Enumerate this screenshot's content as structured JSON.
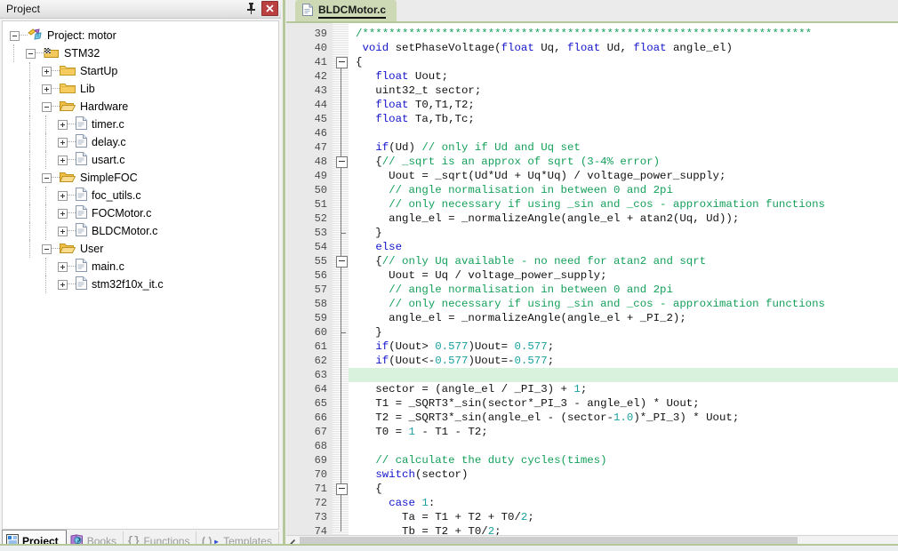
{
  "project_panel": {
    "title": "Project",
    "pin_icon": "pin-icon",
    "close_icon": "close-icon",
    "tree": [
      {
        "label": "Project: motor",
        "depth": 0,
        "expander": "minus",
        "icon": "project-icon"
      },
      {
        "label": "STM32",
        "depth": 1,
        "expander": "minus",
        "icon": "target-icon"
      },
      {
        "label": "StartUp",
        "depth": 2,
        "expander": "plus",
        "icon": "folder-closed-icon"
      },
      {
        "label": "Lib",
        "depth": 2,
        "expander": "plus",
        "icon": "folder-closed-icon"
      },
      {
        "label": "Hardware",
        "depth": 2,
        "expander": "minus",
        "icon": "folder-open-icon"
      },
      {
        "label": "timer.c",
        "depth": 3,
        "expander": "plus",
        "icon": "file-c-icon"
      },
      {
        "label": "delay.c",
        "depth": 3,
        "expander": "plus",
        "icon": "file-c-icon"
      },
      {
        "label": "usart.c",
        "depth": 3,
        "expander": "plus",
        "icon": "file-c-icon"
      },
      {
        "label": "SimpleFOC",
        "depth": 2,
        "expander": "minus",
        "icon": "folder-open-icon"
      },
      {
        "label": "foc_utils.c",
        "depth": 3,
        "expander": "plus",
        "icon": "file-c-icon"
      },
      {
        "label": "FOCMotor.c",
        "depth": 3,
        "expander": "plus",
        "icon": "file-c-icon"
      },
      {
        "label": "BLDCMotor.c",
        "depth": 3,
        "expander": "plus",
        "icon": "file-c-icon"
      },
      {
        "label": "User",
        "depth": 2,
        "expander": "minus",
        "icon": "folder-open-icon"
      },
      {
        "label": "main.c",
        "depth": 3,
        "expander": "plus",
        "icon": "file-c-icon"
      },
      {
        "label": "stm32f10x_it.c",
        "depth": 3,
        "expander": "plus",
        "icon": "file-c-icon"
      }
    ],
    "bottom_tabs": [
      {
        "label": "Project",
        "active": true,
        "icon": "project-tab-icon"
      },
      {
        "label": "Books",
        "active": false,
        "icon": "books-icon"
      },
      {
        "label": "Functions",
        "active": false,
        "icon": "braces-icon"
      },
      {
        "label": "Templates",
        "active": false,
        "icon": "templates-icon"
      }
    ]
  },
  "editor": {
    "tab": {
      "label": "BLDCMotor.c",
      "icon": "file-c-icon",
      "active": true
    },
    "first_line_number": 39,
    "current_line": 63,
    "scrollbar": {
      "left_arrow_icon": "chevron-left-icon"
    },
    "folds": [
      {
        "line": 41,
        "type": "open"
      },
      {
        "line": 48,
        "type": "open"
      },
      {
        "line": 53,
        "type": "end"
      },
      {
        "line": 55,
        "type": "open"
      },
      {
        "line": 60,
        "type": "end"
      },
      {
        "line": 71,
        "type": "open"
      }
    ],
    "lines": [
      {
        "n": 39,
        "tokens": [
          {
            "t": "cm",
            "s": "/********************************************************************"
          }
        ]
      },
      {
        "n": 40,
        "tokens": [
          {
            "t": "pl",
            "s": " "
          },
          {
            "t": "kw",
            "s": "void"
          },
          {
            "t": "pl",
            "s": " setPhaseVoltage("
          },
          {
            "t": "kw",
            "s": "float"
          },
          {
            "t": "pl",
            "s": " Uq, "
          },
          {
            "t": "kw",
            "s": "float"
          },
          {
            "t": "pl",
            "s": " Ud, "
          },
          {
            "t": "kw",
            "s": "float"
          },
          {
            "t": "pl",
            "s": " angle_el)"
          }
        ]
      },
      {
        "n": 41,
        "tokens": [
          {
            "t": "pl",
            "s": "{"
          }
        ]
      },
      {
        "n": 42,
        "tokens": [
          {
            "t": "pl",
            "s": "   "
          },
          {
            "t": "kw",
            "s": "float"
          },
          {
            "t": "pl",
            "s": " Uout;"
          }
        ]
      },
      {
        "n": 43,
        "tokens": [
          {
            "t": "pl",
            "s": "   uint32_t sector;"
          }
        ]
      },
      {
        "n": 44,
        "tokens": [
          {
            "t": "pl",
            "s": "   "
          },
          {
            "t": "kw",
            "s": "float"
          },
          {
            "t": "pl",
            "s": " T0,T1,T2;"
          }
        ]
      },
      {
        "n": 45,
        "tokens": [
          {
            "t": "pl",
            "s": "   "
          },
          {
            "t": "kw",
            "s": "float"
          },
          {
            "t": "pl",
            "s": " Ta,Tb,Tc;"
          }
        ]
      },
      {
        "n": 46,
        "tokens": [
          {
            "t": "pl",
            "s": ""
          }
        ]
      },
      {
        "n": 47,
        "tokens": [
          {
            "t": "pl",
            "s": "   "
          },
          {
            "t": "kw",
            "s": "if"
          },
          {
            "t": "pl",
            "s": "(Ud) "
          },
          {
            "t": "cm",
            "s": "// only if Ud and Uq set"
          }
        ]
      },
      {
        "n": 48,
        "tokens": [
          {
            "t": "pl",
            "s": "   {"
          },
          {
            "t": "cm",
            "s": "// _sqrt is an approx of sqrt (3-4% error)"
          }
        ]
      },
      {
        "n": 49,
        "tokens": [
          {
            "t": "pl",
            "s": "     Uout = _sqrt(Ud*Ud + Uq*Uq) / voltage_power_supply;"
          }
        ]
      },
      {
        "n": 50,
        "tokens": [
          {
            "t": "pl",
            "s": "     "
          },
          {
            "t": "cm",
            "s": "// angle normalisation in between 0 and 2pi"
          }
        ]
      },
      {
        "n": 51,
        "tokens": [
          {
            "t": "pl",
            "s": "     "
          },
          {
            "t": "cm",
            "s": "// only necessary if using _sin and _cos - approximation functions"
          }
        ]
      },
      {
        "n": 52,
        "tokens": [
          {
            "t": "pl",
            "s": "     angle_el = _normalizeAngle(angle_el + atan2(Uq, Ud));"
          }
        ]
      },
      {
        "n": 53,
        "tokens": [
          {
            "t": "pl",
            "s": "   }"
          }
        ]
      },
      {
        "n": 54,
        "tokens": [
          {
            "t": "pl",
            "s": "   "
          },
          {
            "t": "kw",
            "s": "else"
          }
        ]
      },
      {
        "n": 55,
        "tokens": [
          {
            "t": "pl",
            "s": "   {"
          },
          {
            "t": "cm",
            "s": "// only Uq available - no need for atan2 and sqrt"
          }
        ]
      },
      {
        "n": 56,
        "tokens": [
          {
            "t": "pl",
            "s": "     Uout = Uq / voltage_power_supply;"
          }
        ]
      },
      {
        "n": 57,
        "tokens": [
          {
            "t": "pl",
            "s": "     "
          },
          {
            "t": "cm",
            "s": "// angle normalisation in between 0 and 2pi"
          }
        ]
      },
      {
        "n": 58,
        "tokens": [
          {
            "t": "pl",
            "s": "     "
          },
          {
            "t": "cm",
            "s": "// only necessary if using _sin and _cos - approximation functions"
          }
        ]
      },
      {
        "n": 59,
        "tokens": [
          {
            "t": "pl",
            "s": "     angle_el = _normalizeAngle(angle_el + _PI_2);"
          }
        ]
      },
      {
        "n": 60,
        "tokens": [
          {
            "t": "pl",
            "s": "   }"
          }
        ]
      },
      {
        "n": 61,
        "tokens": [
          {
            "t": "pl",
            "s": "   "
          },
          {
            "t": "kw",
            "s": "if"
          },
          {
            "t": "pl",
            "s": "(Uout> "
          },
          {
            "t": "num",
            "s": "0.577"
          },
          {
            "t": "pl",
            "s": ")Uout= "
          },
          {
            "t": "num",
            "s": "0.577"
          },
          {
            "t": "pl",
            "s": ";"
          }
        ]
      },
      {
        "n": 62,
        "tokens": [
          {
            "t": "pl",
            "s": "   "
          },
          {
            "t": "kw",
            "s": "if"
          },
          {
            "t": "pl",
            "s": "(Uout<-"
          },
          {
            "t": "num",
            "s": "0.577"
          },
          {
            "t": "pl",
            "s": ")Uout=-"
          },
          {
            "t": "num",
            "s": "0.577"
          },
          {
            "t": "pl",
            "s": ";"
          }
        ]
      },
      {
        "n": 63,
        "tokens": [
          {
            "t": "pl",
            "s": ""
          }
        ]
      },
      {
        "n": 64,
        "tokens": [
          {
            "t": "pl",
            "s": "   sector = (angle_el / _PI_3) + "
          },
          {
            "t": "num",
            "s": "1"
          },
          {
            "t": "pl",
            "s": ";"
          }
        ]
      },
      {
        "n": 65,
        "tokens": [
          {
            "t": "pl",
            "s": "   T1 = _SQRT3*_sin(sector*_PI_3 - angle_el) * Uout;"
          }
        ]
      },
      {
        "n": 66,
        "tokens": [
          {
            "t": "pl",
            "s": "   T2 = _SQRT3*_sin(angle_el - (sector-"
          },
          {
            "t": "num",
            "s": "1.0"
          },
          {
            "t": "pl",
            "s": ")*_PI_3) * Uout;"
          }
        ]
      },
      {
        "n": 67,
        "tokens": [
          {
            "t": "pl",
            "s": "   T0 = "
          },
          {
            "t": "num",
            "s": "1"
          },
          {
            "t": "pl",
            "s": " - T1 - T2;"
          }
        ]
      },
      {
        "n": 68,
        "tokens": [
          {
            "t": "pl",
            "s": ""
          }
        ]
      },
      {
        "n": 69,
        "tokens": [
          {
            "t": "pl",
            "s": "   "
          },
          {
            "t": "cm",
            "s": "// calculate the duty cycles(times)"
          }
        ]
      },
      {
        "n": 70,
        "tokens": [
          {
            "t": "pl",
            "s": "   "
          },
          {
            "t": "kw",
            "s": "switch"
          },
          {
            "t": "pl",
            "s": "(sector)"
          }
        ]
      },
      {
        "n": 71,
        "tokens": [
          {
            "t": "pl",
            "s": "   {"
          }
        ]
      },
      {
        "n": 72,
        "tokens": [
          {
            "t": "pl",
            "s": "     "
          },
          {
            "t": "kw",
            "s": "case"
          },
          {
            "t": "pl",
            "s": " "
          },
          {
            "t": "num",
            "s": "1"
          },
          {
            "t": "pl",
            "s": ":"
          }
        ]
      },
      {
        "n": 73,
        "tokens": [
          {
            "t": "pl",
            "s": "       Ta = T1 + T2 + T0/"
          },
          {
            "t": "num",
            "s": "2"
          },
          {
            "t": "pl",
            "s": ";"
          }
        ]
      },
      {
        "n": 74,
        "tokens": [
          {
            "t": "pl",
            "s": "       Tb = T2 + T0/"
          },
          {
            "t": "num",
            "s": "2"
          },
          {
            "t": "pl",
            "s": ";"
          }
        ]
      }
    ]
  },
  "colors": {
    "keyword": "#1414cc",
    "comment": "#14a05a",
    "number": "#1ba0a0",
    "plain": "#111111",
    "current_line_bg": "#d9f2dd",
    "tab_accent": "#b6c79a",
    "tab_active_bg": "#cdd9b4",
    "close_button": "#bb4141"
  }
}
